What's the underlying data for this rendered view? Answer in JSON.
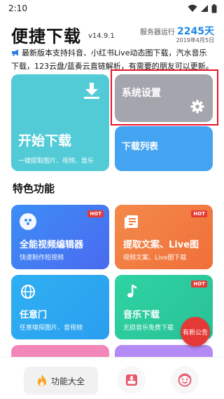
{
  "status_bar": {
    "time": "2:10"
  },
  "header": {
    "title": "便捷下载",
    "version": "v14.9.1",
    "runtime_label": "服务器运行",
    "runtime_days": "2245天",
    "date": "2019年4月5日"
  },
  "notice": {
    "icon": "megaphone-icon",
    "text": "最新版本支持抖音、小红书Live动态图下载，汽水音乐下载，123云盘/蓝奏云直链解析，有需要的朋友可以更新。"
  },
  "cards": {
    "start": {
      "title": "开始下载",
      "subtitle": "一键提取图片、视频、音乐",
      "color": "#52cbd6"
    },
    "settings": {
      "title": "系统设置",
      "color": "#a5a5ae"
    },
    "list": {
      "title": "下载列表",
      "color": "#44a4f2"
    }
  },
  "section": {
    "title": "特色功能"
  },
  "features": [
    {
      "title": "全能视频编辑器",
      "subtitle": "快速制作短视频",
      "badge": "HOT",
      "icon": "video-editor-icon"
    },
    {
      "title": "提取文案、Live图",
      "subtitle": "视频文案、Live图下载",
      "badge": "HOT",
      "icon": "text-extract-icon"
    },
    {
      "title": "任意门",
      "subtitle": "任意嗅探图片、音视频",
      "badge": "",
      "icon": "globe-icon"
    },
    {
      "title": "音乐下载",
      "subtitle": "无损音乐免费下载",
      "badge": "HOT",
      "icon": "music-note-icon"
    }
  ],
  "fab": {
    "label": "有新公告"
  },
  "bottom_nav": {
    "main_label": "功能大全",
    "main_icon": "flame-icon",
    "inbox_icon": "inbox-download-icon",
    "face_icon": "smiley-face-icon"
  }
}
